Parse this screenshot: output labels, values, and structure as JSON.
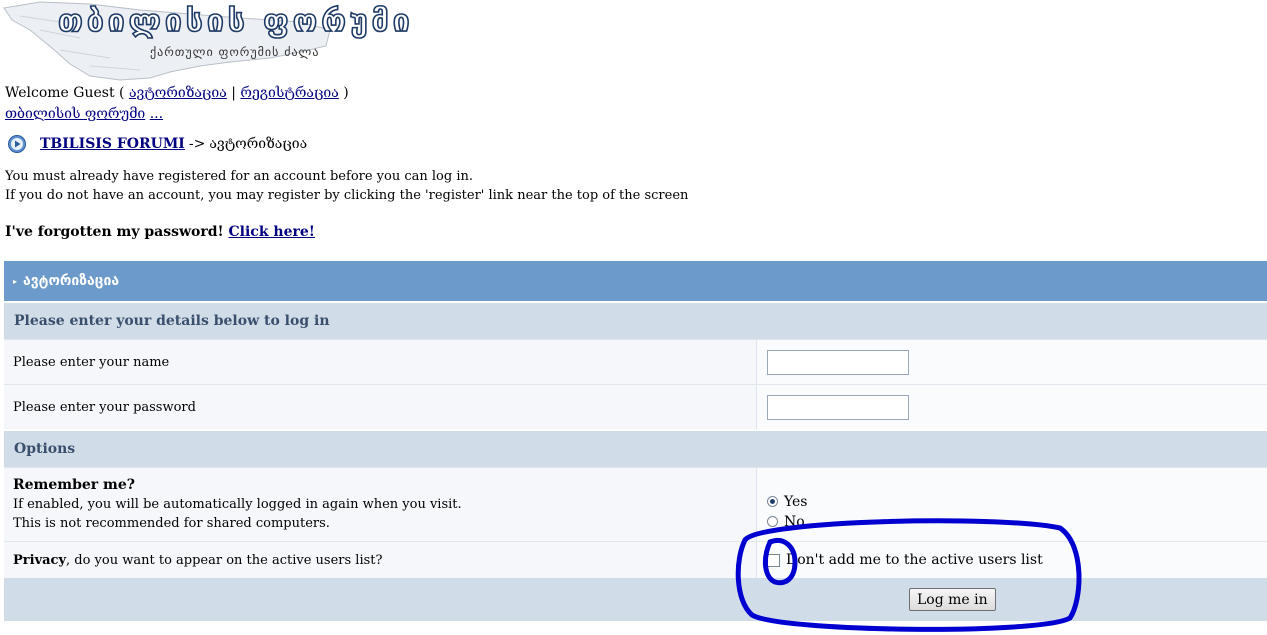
{
  "logo": {
    "title": "თბილისის ფორუმი",
    "subtitle": "ქართული ფორუმის ძალა"
  },
  "welcome": {
    "prefix": "Welcome Guest (",
    "login_link": "ავტორიზაცია",
    "separator": "|",
    "register_link": "რეგისტრაცია",
    "suffix": ")"
  },
  "top_crumb": {
    "forum_link": "თბილისის ფორუმი",
    "more_link": "..."
  },
  "nav": {
    "forum_link": "TBILISIS FORUMI",
    "arrow": "->",
    "current": "ავტორიზაცია"
  },
  "intro": {
    "line1": "You must already have registered for an account before you can log in.",
    "line2": "If you do not have an account, you may register by clicking the 'register' link near the top of the screen"
  },
  "forgot": {
    "text": "I've forgotten my password!",
    "link": "Click here!"
  },
  "form": {
    "title": "ავტორიზაცია",
    "details_header": "Please enter your details below to log in",
    "name_label": "Please enter your name",
    "name_value": "",
    "password_label": "Please enter your password",
    "password_value": "",
    "options_header": "Options",
    "remember_title": "Remember me?",
    "remember_desc1": "If enabled, you will be automatically logged in again when you visit.",
    "remember_desc2": "This is not recommended for shared computers.",
    "remember_yes": "Yes",
    "remember_no": "No",
    "remember_selected": "Yes",
    "privacy_title": "Privacy",
    "privacy_question": ", do you want to appear on the active users list?",
    "privacy_checkbox_label": "Don't add me to the active users list",
    "privacy_checked": false,
    "submit_label": "Log me in"
  },
  "colors": {
    "header_bar": "#6c9bcb",
    "section_bar": "#d1dce9",
    "annotation": "#0000d0"
  }
}
